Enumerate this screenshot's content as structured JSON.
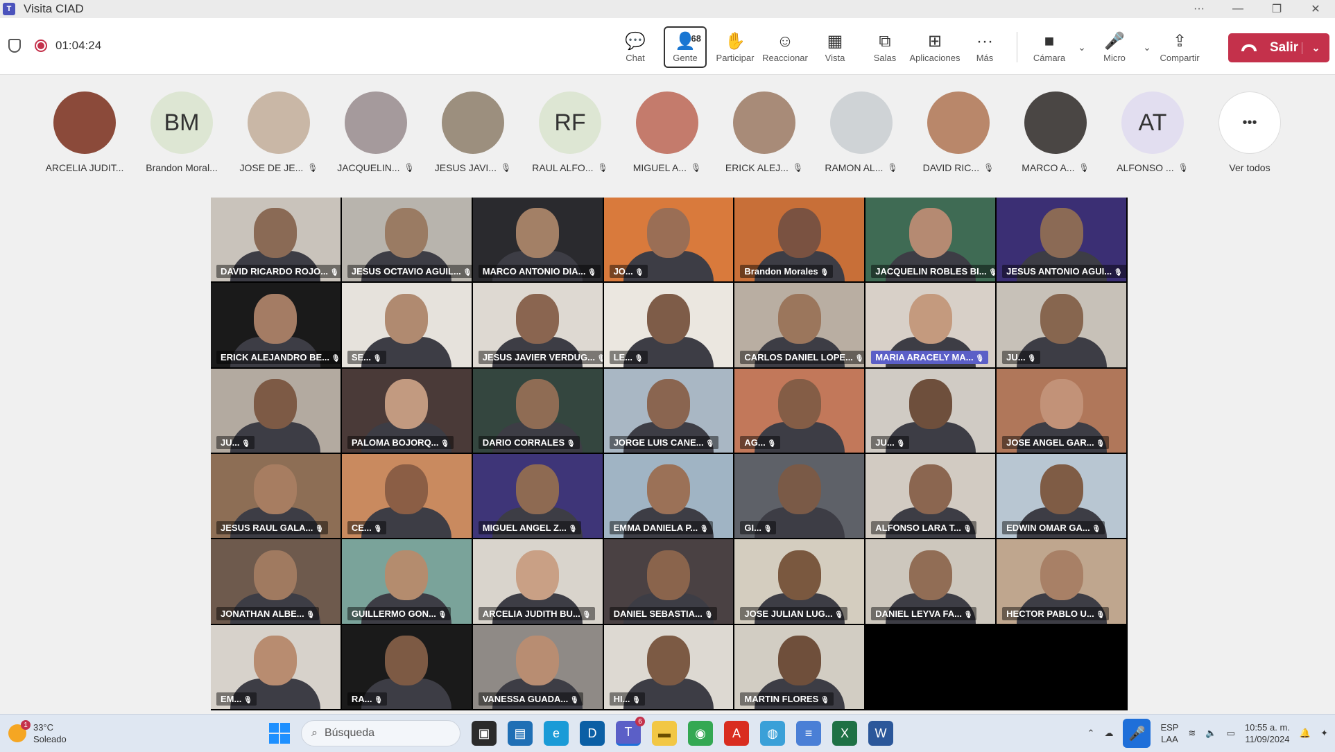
{
  "window": {
    "title": "Visita CIAD"
  },
  "meeting": {
    "timer": "01:04:24"
  },
  "toolbar": {
    "chat": "Chat",
    "people": "Gente",
    "people_count": "68",
    "raise": "Participar",
    "react": "Reaccionar",
    "view": "Vista",
    "rooms": "Salas",
    "apps": "Aplicaciones",
    "more": "Más",
    "camera": "Cámara",
    "mic": "Micro",
    "share": "Compartir",
    "leave": "Salir"
  },
  "participants": [
    {
      "name": "ARCELIA JUDIT...",
      "initials": "",
      "color": "#8b4a3a",
      "muted": false
    },
    {
      "name": "Brandon Moral...",
      "initials": "BM",
      "color": "#dde6d3",
      "muted": false
    },
    {
      "name": "JOSE DE JE...",
      "initials": "",
      "color": "#c9b7a6",
      "muted": true
    },
    {
      "name": "JACQUELIN...",
      "initials": "",
      "color": "#a59a9c",
      "muted": true
    },
    {
      "name": "JESUS JAVI...",
      "initials": "",
      "color": "#9c8f7e",
      "muted": true
    },
    {
      "name": "RAUL ALFO...",
      "initials": "RF",
      "color": "#dde6d3",
      "muted": true
    },
    {
      "name": "MIGUEL A...",
      "initials": "",
      "color": "#c47b6c",
      "muted": true
    },
    {
      "name": "ERICK ALEJ...",
      "initials": "",
      "color": "#a88b78",
      "muted": true
    },
    {
      "name": "RAMON AL...",
      "initials": "",
      "color": "#cfd3d6",
      "muted": true
    },
    {
      "name": "DAVID RIC...",
      "initials": "",
      "color": "#b9876a",
      "muted": true
    },
    {
      "name": "MARCO A...",
      "initials": "",
      "color": "#4a4644",
      "muted": true
    },
    {
      "name": "ALFONSO ...",
      "initials": "AT",
      "color": "#e2def0",
      "muted": true
    }
  ],
  "see_all": {
    "label": "Ver todos",
    "glyph": "•••"
  },
  "tiles": [
    {
      "name": "DAVID RICARDO ROJO...",
      "bg": "#c9c3bb",
      "skin": "#8a6a55",
      "hl": false
    },
    {
      "name": "JESUS OCTAVIO AGUIL...",
      "bg": "#b8b4ad",
      "skin": "#9a7b63",
      "hl": false
    },
    {
      "name": "MARCO ANTONIO DIA...",
      "bg": "#2a2a2e",
      "skin": "#a38066",
      "hl": false
    },
    {
      "name": "JO...",
      "bg": "#d97a3c",
      "skin": "#9a6e55",
      "hl": false
    },
    {
      "name": "Brandon Morales",
      "bg": "#c86f38",
      "skin": "#7a5241",
      "hl": false
    },
    {
      "name": "JACQUELIN ROBLES BI...",
      "bg": "#3f6b54",
      "skin": "#b58a72",
      "hl": false
    },
    {
      "name": "JESUS ANTONIO AGUI...",
      "bg": "#3b2f74",
      "skin": "#8b6a55",
      "hl": false
    },
    {
      "name": "ERICK ALEJANDRO BE...",
      "bg": "#1a1a1a",
      "skin": "#a47c64",
      "hl": false
    },
    {
      "name": "SE...",
      "bg": "#e6e2dc",
      "skin": "#b08a70",
      "hl": false
    },
    {
      "name": "JESUS JAVIER VERDUG...",
      "bg": "#ded9d2",
      "skin": "#8a6550",
      "hl": false
    },
    {
      "name": "LE...",
      "bg": "#ebe7e0",
      "skin": "#7e5c48",
      "hl": false
    },
    {
      "name": "CARLOS DANIEL LOPE...",
      "bg": "#b9aea2",
      "skin": "#9b765c",
      "hl": false
    },
    {
      "name": "MARIA ARACELY MA...",
      "bg": "#d8d0c8",
      "skin": "#c49a7e",
      "hl": true
    },
    {
      "name": "JU...",
      "bg": "#c7c1b8",
      "skin": "#87664f",
      "hl": false
    },
    {
      "name": "JU...",
      "bg": "#b3aaa0",
      "skin": "#7d5a45",
      "hl": false
    },
    {
      "name": "PALOMA BOJORQ...",
      "bg": "#4a3a38",
      "skin": "#c29a80",
      "hl": false
    },
    {
      "name": "DARIO CORRALES",
      "bg": "#34463f",
      "skin": "#8f6c54",
      "hl": false
    },
    {
      "name": "JORGE LUIS CANE...",
      "bg": "#a9b7c4",
      "skin": "#8a6550",
      "hl": false
    },
    {
      "name": "AG...",
      "bg": "#c2785a",
      "skin": "#845d46",
      "hl": false
    },
    {
      "name": "JU...",
      "bg": "#d0cbc4",
      "skin": "#6e4f3c",
      "hl": false
    },
    {
      "name": "JOSE ANGEL GAR...",
      "bg": "#b0775a",
      "skin": "#c29278",
      "hl": false
    },
    {
      "name": "JESUS RAUL GALA...",
      "bg": "#8d6e55",
      "skin": "#a77d61",
      "hl": false
    },
    {
      "name": "CE...",
      "bg": "#c98a5f",
      "skin": "#8b5e45",
      "hl": false
    },
    {
      "name": "MIGUEL ANGEL Z...",
      "bg": "#3e3578",
      "skin": "#8e6a52",
      "hl": false
    },
    {
      "name": "EMMA DANIELA P...",
      "bg": "#a0b4c4",
      "skin": "#9b7157",
      "hl": false
    },
    {
      "name": "GI...",
      "bg": "#5e6168",
      "skin": "#7a5a47",
      "hl": false
    },
    {
      "name": "ALFONSO LARA T...",
      "bg": "#d2cbc2",
      "skin": "#8b6650",
      "hl": false
    },
    {
      "name": "EDWIN OMAR GA...",
      "bg": "#b8c6d2",
      "skin": "#7f5c45",
      "hl": false
    },
    {
      "name": "JONATHAN ALBE...",
      "bg": "#6e5a4d",
      "skin": "#a07a60",
      "hl": false
    },
    {
      "name": "GUILLERMO GON...",
      "bg": "#7aa39a",
      "skin": "#b48c6e",
      "hl": false
    },
    {
      "name": "ARCELIA JUDITH BU...",
      "bg": "#d9d4cc",
      "skin": "#c9a085",
      "hl": false
    },
    {
      "name": "DANIEL SEBASTIA...",
      "bg": "#4a4143",
      "skin": "#8a644c",
      "hl": false
    },
    {
      "name": "JOSE JULIAN LUG...",
      "bg": "#d4cdbf",
      "skin": "#7a583f",
      "hl": false
    },
    {
      "name": "DANIEL LEYVA FA...",
      "bg": "#cdc7bd",
      "skin": "#916d55",
      "hl": false
    },
    {
      "name": "HECTOR PABLO U...",
      "bg": "#bfa68e",
      "skin": "#a88066",
      "hl": false
    },
    {
      "name": "EM...",
      "bg": "#d7d2cb",
      "skin": "#b88c70",
      "hl": false
    },
    {
      "name": "RA...",
      "bg": "#1a1a1a",
      "skin": "#7d5a44",
      "hl": false
    },
    {
      "name": "VANESSA GUADA...",
      "bg": "#8f8a86",
      "skin": "#b88d72",
      "hl": false
    },
    {
      "name": "HI...",
      "bg": "#ddd9d2",
      "skin": "#7c5a44",
      "hl": false
    },
    {
      "name": "MARTIN FLORES",
      "bg": "#d2cdc3",
      "skin": "#6f4f3b",
      "hl": false
    }
  ],
  "taskbar": {
    "temp": "33°C",
    "weather": "Soleado",
    "weather_badge": "1",
    "search_placeholder": "Búsqueda",
    "teams_badge": "6",
    "lang1": "ESP",
    "lang2": "LAA",
    "time": "10:55 a. m.",
    "date": "11/09/2024"
  }
}
